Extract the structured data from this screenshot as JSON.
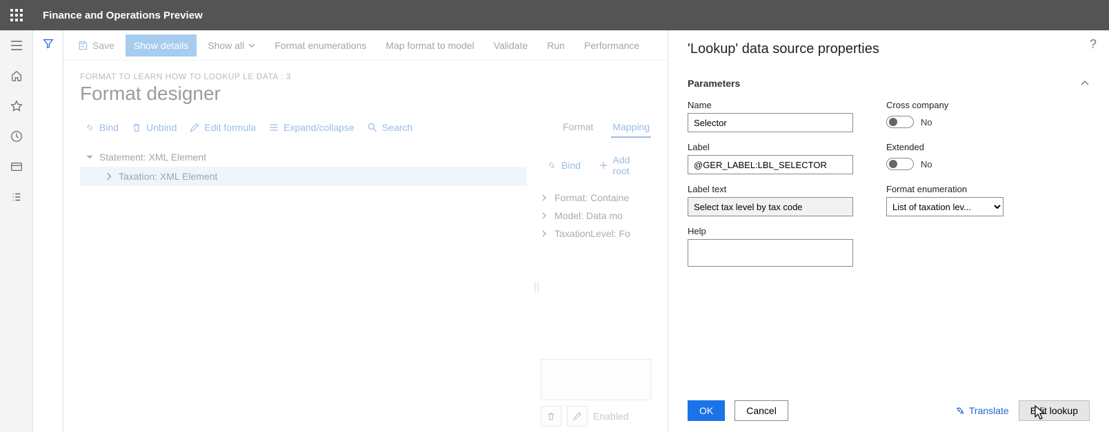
{
  "header": {
    "app_title": "Finance and Operations Preview"
  },
  "toolbar": {
    "save": "Save",
    "show_details": "Show details",
    "show_all": "Show all",
    "format_enum": "Format enumerations",
    "map_format": "Map format to model",
    "validate": "Validate",
    "run": "Run",
    "performance": "Performance"
  },
  "page": {
    "breadcrumb": "FORMAT TO LEARN HOW TO LOOKUP LE DATA : 3",
    "title": "Format designer"
  },
  "actions": {
    "bind": "Bind",
    "unbind": "Unbind",
    "edit_formula": "Edit formula",
    "expand": "Expand/collapse",
    "search": "Search"
  },
  "tree": {
    "root": "Statement: XML Element",
    "child": "Taxation: XML Element"
  },
  "mapping": {
    "tab_format": "Format",
    "tab_mapping": "Mapping",
    "bind": "Bind",
    "add_root": "Add root",
    "ds": {
      "format": "Format: Containe",
      "model": "Model: Data mo",
      "tax": "TaxationLevel: Fo"
    },
    "enabled": "Enabled"
  },
  "panel": {
    "title": "'Lookup' data source properties",
    "section": "Parameters",
    "name_label": "Name",
    "name_value": "Selector",
    "label_label": "Label",
    "label_value": "@GER_LABEL:LBL_SELECTOR",
    "labeltext_label": "Label text",
    "labeltext_value": "Select tax level by tax code",
    "help_label": "Help",
    "help_value": "",
    "cross_label": "Cross company",
    "cross_value": "No",
    "extended_label": "Extended",
    "extended_value": "No",
    "fmt_enum_label": "Format enumeration",
    "fmt_enum_value": "List of taxation lev...",
    "ok": "OK",
    "cancel": "Cancel",
    "translate": "Translate",
    "edit_lookup": "Edit lookup"
  }
}
